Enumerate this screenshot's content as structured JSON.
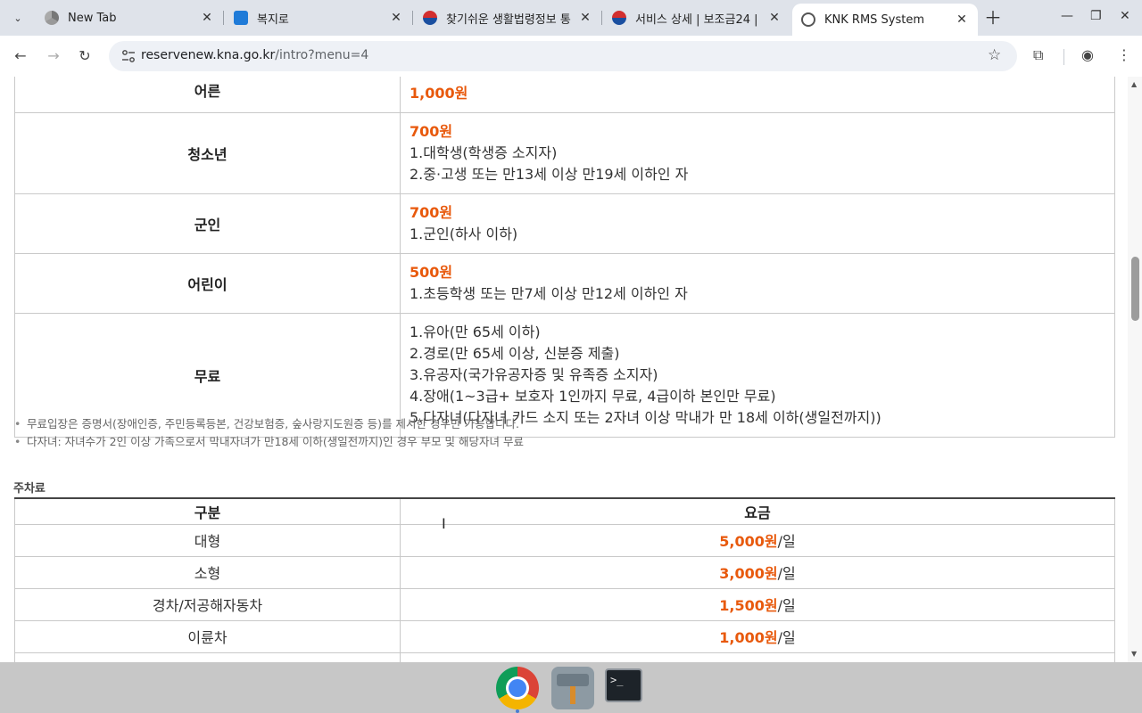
{
  "browser": {
    "tabs": [
      {
        "title": "New Tab",
        "icon": "chrome-icon"
      },
      {
        "title": "복지로",
        "icon": "bokjiro-icon"
      },
      {
        "title": "찾기쉬운 생활법령정보 통",
        "icon": "korea-gov-icon"
      },
      {
        "title": "서비스 상세 | 보조금24 |",
        "icon": "korea-gov-icon"
      },
      {
        "title": "KNK RMS System",
        "icon": "globe-icon",
        "active": true
      }
    ],
    "url_host": "reservenew.kna.go.kr",
    "url_path": "/intro?menu=4"
  },
  "fees": {
    "rows": [
      {
        "category": "어른",
        "price": "1,000원",
        "lines": []
      },
      {
        "category": "청소년",
        "price": "700원",
        "lines": [
          "1.대학생(학생증 소지자)",
          "2.중·고생 또는 만13세 이상 만19세 이하인 자"
        ]
      },
      {
        "category": "군인",
        "price": "700원",
        "lines": [
          "1.군인(하사 이하)"
        ]
      },
      {
        "category": "어린이",
        "price": "500원",
        "lines": [
          "1.초등학생 또는 만7세 이상 만12세 이하인 자"
        ]
      },
      {
        "category": "무료",
        "price": "",
        "lines": [
          "1.유아(만 65세 이하)",
          "2.경로(만 65세 이상, 신분증 제출)",
          "3.유공자(국가유공자증 및 유족증 소지자)",
          "4.장애(1~3급+ 보호자 1인까지 무료, 4급이하 본인만 무료)",
          "5.다자녀(다자녀 카드 소지 또는 2자녀 이상 막내가 만 18세 이하(생일전까지))"
        ]
      }
    ],
    "notes": [
      "무료입장은 증명서(장애인증, 주민등록등본, 건강보험증, 숲사랑지도원증 등)를 제시한 경우만 가능합니다.",
      "다자녀: 자녀수가 2인 이상 가족으로서 막내자녀가 만18세 이하(생일전까지)인 경우 부모 및 해당자녀 무료"
    ]
  },
  "parking": {
    "title": "주차료",
    "headers": [
      "구분",
      "요금"
    ],
    "unit": "/일",
    "rows": [
      {
        "type": "대형",
        "price": "5,000원"
      },
      {
        "type": "소형",
        "price": "3,000원"
      },
      {
        "type": "경차/저공해자동차",
        "price": "1,500원"
      },
      {
        "type": "이륜차",
        "price": "1,000원"
      }
    ]
  },
  "colors": {
    "price": "#e8590c"
  }
}
